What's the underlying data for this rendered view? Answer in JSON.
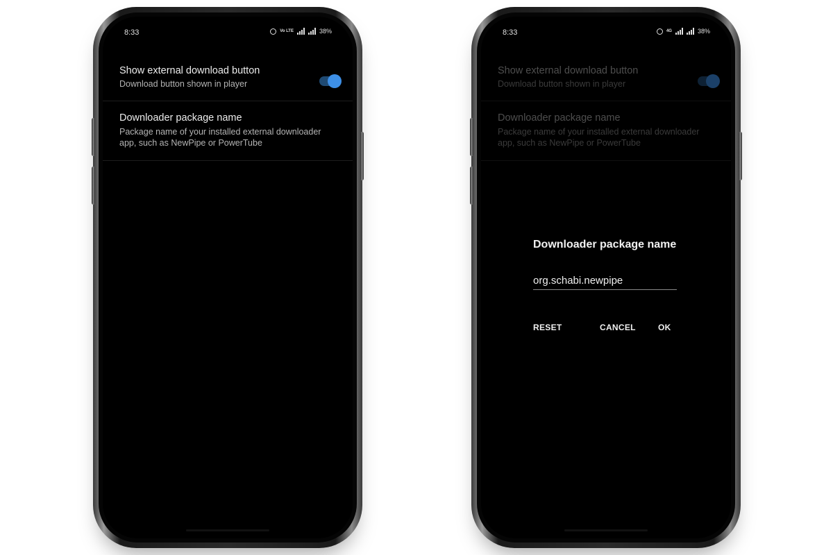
{
  "status": {
    "time": "8:33",
    "battery": "38%",
    "volte": "Vo LTE",
    "network": "4G"
  },
  "prefs": {
    "show_download": {
      "title": "Show external download button",
      "summary": "Download button shown in player",
      "enabled": true
    },
    "package_name": {
      "title": "Downloader package name",
      "summary": "Package name of your installed external downloader app, such as NewPipe or PowerTube"
    }
  },
  "dialog": {
    "title": "Downloader package name",
    "value": "org.schabi.newpipe",
    "reset": "RESET",
    "cancel": "CANCEL",
    "ok": "OK"
  },
  "colors": {
    "accent": "#3d8fe6",
    "background": "#000000"
  }
}
